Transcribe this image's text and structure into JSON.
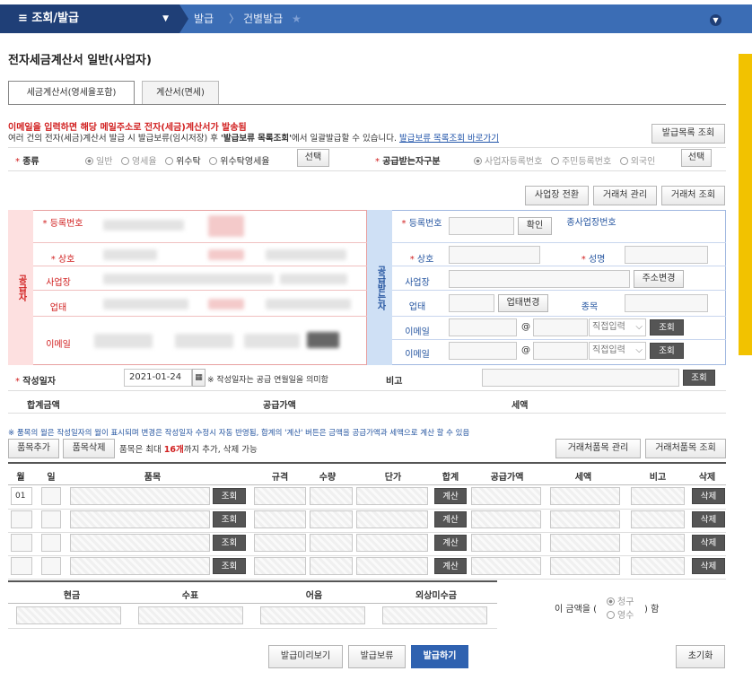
{
  "nav": {
    "menu_label": "조회/발급",
    "crumbs": [
      "발급",
      "건별발급"
    ]
  },
  "page_title": "전자세금계산서 일반(사업자)",
  "tabs": [
    {
      "label": "세금계산서(영세율포함)"
    },
    {
      "label": "계산서(면세)"
    }
  ],
  "notice": {
    "line1": "이메일을 입력하면 해당 메일주소로 전자(세금)계산서가 발송됨",
    "line2_a": "여러 건의 전자(세금)계산서 발급 시 발급보류(임시저장) 후",
    "line2_b": "'발급보류 목록조회'",
    "line2_c": "에서 일괄발급할 수 있습니다.",
    "line2_link": "발급보류 목록조회 바로가기"
  },
  "buttons": {
    "issue_list": "발급목록 조회",
    "select": "선택",
    "biz_switch": "사업장 전환",
    "partner_manage": "거래처 관리",
    "partner_search": "거래처 조회",
    "confirm": "확인",
    "address_change": "주소변경",
    "industry_change": "업태변경",
    "search": "조회",
    "calc": "계산",
    "delete": "삭제",
    "item_add": "품목추가",
    "item_delete": "품목삭제",
    "partner_item_manage": "거래처품목 관리",
    "partner_item_search": "거래처품목 조회",
    "preview": "발급미리보기",
    "hold": "발급보류",
    "issue": "발급하기",
    "reset": "초기화"
  },
  "type_row": {
    "label": "종류",
    "options": [
      "일반",
      "영세율",
      "위수탁",
      "위수탁영세율"
    ]
  },
  "buyer_type": {
    "label": "공급받는자구분",
    "options": [
      "사업자등록번호",
      "주민등록번호",
      "외국인"
    ]
  },
  "supplier": {
    "side_label": "공급자",
    "fields": [
      "등록번호",
      "상호",
      "사업장",
      "업태",
      "이메일"
    ],
    "sub_label": "성명",
    "sub_label2": "종목"
  },
  "buyer": {
    "side_label": "공급받는자",
    "fields": [
      "등록번호",
      "상호",
      "사업장",
      "업태",
      "이메일",
      "이메일"
    ],
    "biz_no_label": "종사업장번호",
    "name_label": "성명",
    "item_label": "종목",
    "email_select": "직접입력",
    "at": "@"
  },
  "date_row": {
    "label": "작성일자",
    "value": "2021-01-24",
    "note": "※ 작성일자는 공급 연월일을 의미함",
    "remark_label": "비고"
  },
  "totals": {
    "total_label": "합계금액",
    "supply_label": "공급가액",
    "tax_label": "세액"
  },
  "item_note": "※ 품목의 월은 작성일자의 월이 표시되며 변경은 작성일자 수정시 자동 반영됨, 합계의 '계산' 버튼은 금액을 공급가액과 세액으로 계산 할 수 있음",
  "item_limit": {
    "pre": "품목은 최대",
    "count": "16개",
    "post": "까지 추가, 삭제 가능"
  },
  "item_table": {
    "headers": [
      "월",
      "일",
      "품목",
      "규격",
      "수량",
      "단가",
      "합계",
      "공급가액",
      "세액",
      "비고",
      "삭제"
    ],
    "first_month": "01"
  },
  "payment": {
    "headers": [
      "현금",
      "수표",
      "어음",
      "외상미수금"
    ],
    "amount_pre": "이 금액을 (",
    "options": [
      "청구",
      "영수"
    ],
    "amount_post": ") 함"
  }
}
